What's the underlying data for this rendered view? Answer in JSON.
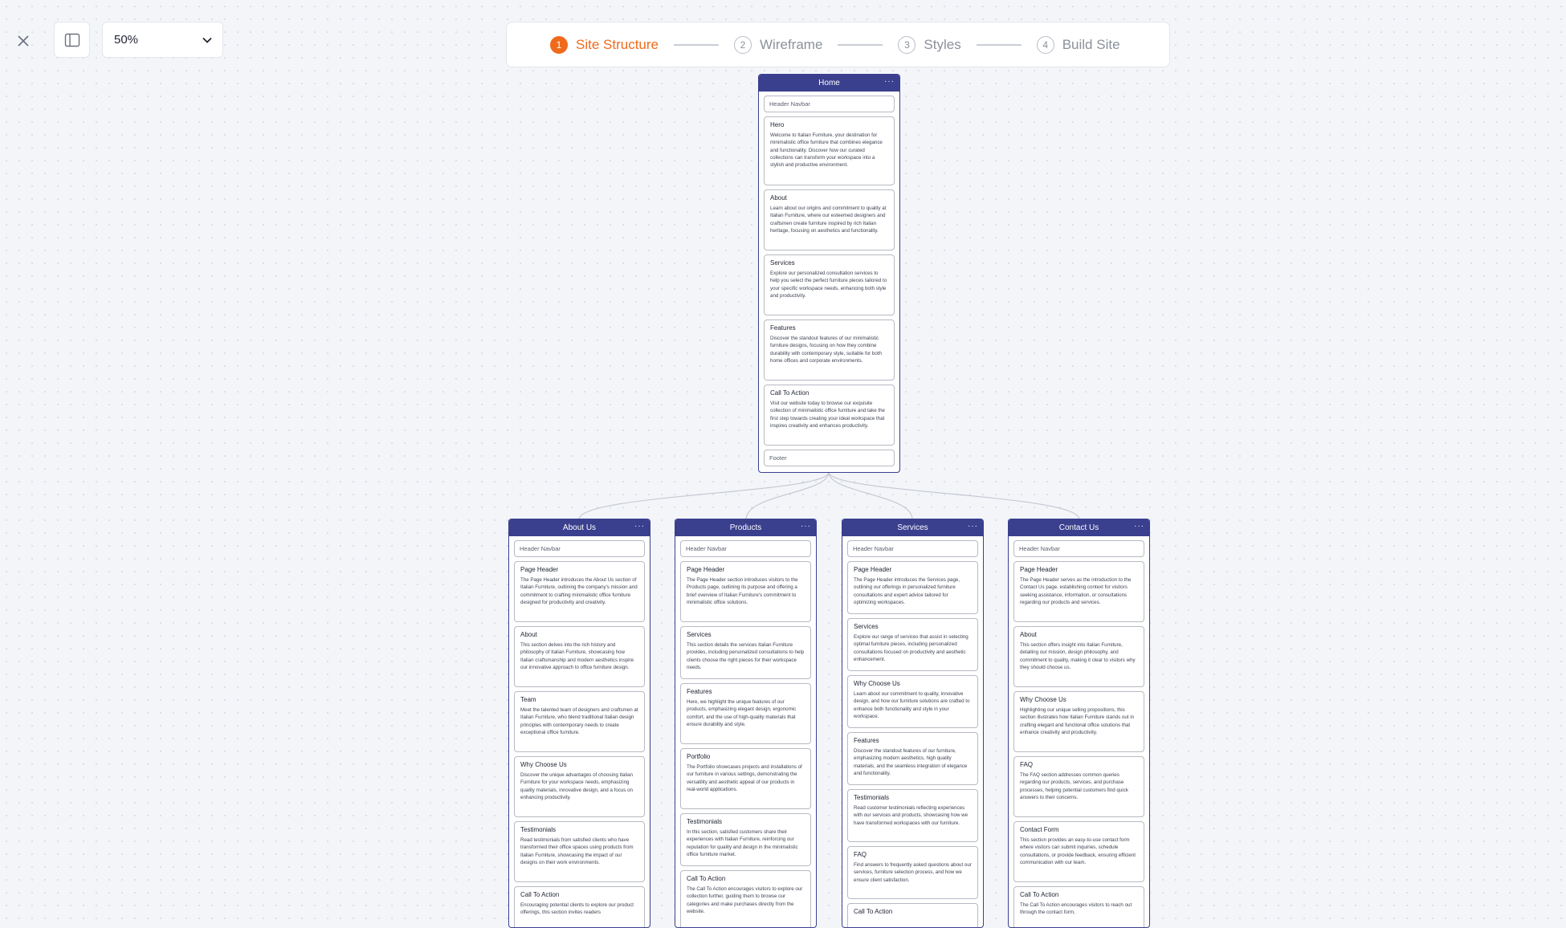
{
  "toolbar": {
    "close_icon": "close-icon",
    "panel_icon": "sidebar-panel-icon",
    "zoom": "50%"
  },
  "steps": [
    {
      "num": "1",
      "label": "Site Structure",
      "active": true
    },
    {
      "num": "2",
      "label": "Wireframe",
      "active": false
    },
    {
      "num": "3",
      "label": "Styles",
      "active": false
    },
    {
      "num": "4",
      "label": "Build Site",
      "active": false
    }
  ],
  "colors": {
    "accent": "#f06a1b",
    "card_header": "#3a3f8e"
  },
  "pages": {
    "home": {
      "title": "Home",
      "more": "···",
      "header_slot": "Header Navbar",
      "footer_slot": "Footer",
      "sections": [
        {
          "title": "Hero",
          "desc": "Welcome to Italian Furniture, your destination for minimalistic office furniture that combines elegance and functionality. Discover how our curated collections can transform your workspace into a stylish and productive environment."
        },
        {
          "title": "About",
          "desc": "Learn about our origins and commitment to quality at Italian Furniture, where our esteemed designers and craftsmen create furniture inspired by rich Italian heritage, focusing on aesthetics and functionality."
        },
        {
          "title": "Services",
          "desc": "Explore our personalized consultation services to help you select the perfect furniture pieces tailored to your specific workspace needs, enhancing both style and productivity."
        },
        {
          "title": "Features",
          "desc": "Discover the standout features of our minimalistic furniture designs, focusing on how they combine durability with contemporary style, suitable for both home offices and corporate environments."
        },
        {
          "title": "Call To Action",
          "desc": "Visit our website today to browse our exquisite collection of minimalistic office furniture and take the first step towards creating your ideal workspace that inspires creativity and enhances productivity."
        }
      ]
    },
    "about": {
      "title": "About Us",
      "more": "···",
      "header_slot": "Header Navbar",
      "sections": [
        {
          "title": "Page Header",
          "desc": "The Page Header introduces the About Us section of Italian Furniture, outlining the company's mission and commitment to crafting minimalistic office furniture designed for productivity and creativity."
        },
        {
          "title": "About",
          "desc": "This section delves into the rich history and philosophy of Italian Furniture, showcasing how Italian craftsmanship and modern aesthetics inspire our innovative approach to office furniture design."
        },
        {
          "title": "Team",
          "desc": "Meet the talented team of designers and craftsmen at Italian Furniture, who blend traditional Italian design principles with contemporary needs to create exceptional office furniture."
        },
        {
          "title": "Why Choose Us",
          "desc": "Discover the unique advantages of choosing Italian Furniture for your workspace needs, emphasizing quality materials, innovative design, and a focus on enhancing productivity."
        },
        {
          "title": "Testimonials",
          "desc": "Read testimonials from satisfied clients who have transformed their office spaces using products from Italian Furniture, showcasing the impact of our designs on their work environments."
        },
        {
          "title": "Call To Action",
          "desc": "Encouraging potential clients to explore our product offerings, this section invites readers"
        }
      ]
    },
    "products": {
      "title": "Products",
      "more": "···",
      "header_slot": "Header Navbar",
      "sections": [
        {
          "title": "Page Header",
          "desc": "The Page Header section introduces visitors to the Products page, outlining its purpose and offering a brief overview of Italian Furniture's commitment to minimalistic office solutions."
        },
        {
          "title": "Services",
          "desc": "This section details the services Italian Furniture provides, including personalized consultations to help clients choose the right pieces for their workspace needs."
        },
        {
          "title": "Features",
          "desc": "Here, we highlight the unique features of our products, emphasizing elegant design, ergonomic comfort, and the use of high-quality materials that ensure durability and style."
        },
        {
          "title": "Portfolio",
          "desc": "The Portfolio showcases projects and installations of our furniture in various settings, demonstrating the versatility and aesthetic appeal of our products in real-world applications."
        },
        {
          "title": "Testimonials",
          "desc": "In this section, satisfied customers share their experiences with Italian Furniture, reinforcing our reputation for quality and design in the minimalistic office furniture market."
        },
        {
          "title": "Call To Action",
          "desc": "The Call To Action encourages visitors to explore our collection further, guiding them to browse our categories and make purchases directly from the website."
        }
      ]
    },
    "services": {
      "title": "Services",
      "more": "···",
      "header_slot": "Header Navbar",
      "sections": [
        {
          "title": "Page Header",
          "desc": "The Page Header introduces the Services page, outlining our offerings in personalized furniture consultations and expert advice tailored for optimizing workspaces."
        },
        {
          "title": "Services",
          "desc": "Explore our range of services that assist in selecting optimal furniture pieces, including personalized consultations focused on productivity and aesthetic enhancement."
        },
        {
          "title": "Why Choose Us",
          "desc": "Learn about our commitment to quality, innovative design, and how our furniture solutions are crafted to enhance both functionality and style in your workspace."
        },
        {
          "title": "Features",
          "desc": "Discover the standout features of our furniture, emphasizing modern aesthetics, high quality materials, and the seamless integration of elegance and functionality."
        },
        {
          "title": "Testimonials",
          "desc": "Read customer testimonials reflecting experiences with our services and products, showcasing how we have transformed workspaces with our furniture."
        },
        {
          "title": "FAQ",
          "desc": "Find answers to frequently asked questions about our services, furniture selection process, and how we ensure client satisfaction."
        },
        {
          "title": "Call To Action",
          "desc": ""
        }
      ]
    },
    "contact": {
      "title": "Contact Us",
      "more": "···",
      "header_slot": "Header Navbar",
      "sections": [
        {
          "title": "Page Header",
          "desc": "The Page Header serves as the introduction to the Contact Us page, establishing context for visitors seeking assistance, information, or consultations regarding our products and services."
        },
        {
          "title": "About",
          "desc": "This section offers insight into Italian Furniture, detailing our mission, design philosophy, and commitment to quality, making it clear to visitors why they should choose us."
        },
        {
          "title": "Why Choose Us",
          "desc": "Highlighting our unique selling propositions, this section illustrates how Italian Furniture stands out in crafting elegant and functional office solutions that enhance creativity and productivity."
        },
        {
          "title": "FAQ",
          "desc": "The FAQ section addresses common queries regarding our products, services, and purchase processes, helping potential customers find quick answers to their concerns."
        },
        {
          "title": "Contact Form",
          "desc": "This section provides an easy-to-use contact form where visitors can submit inquiries, schedule consultations, or provide feedback, ensuring efficient communication with our team."
        },
        {
          "title": "Call To Action",
          "desc": "The Call To Action encourages visitors to reach out through the contact form,"
        }
      ]
    }
  }
}
